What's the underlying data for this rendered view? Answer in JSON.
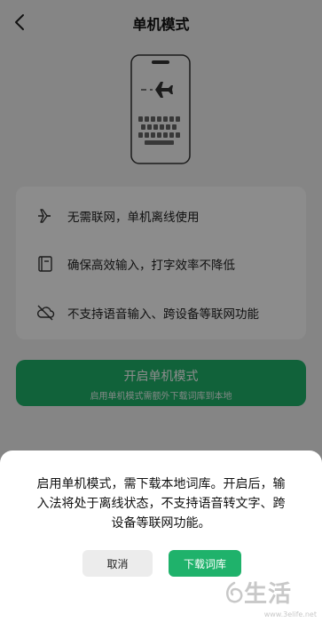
{
  "header": {
    "title": "单机模式"
  },
  "features": [
    {
      "icon": "airplane-icon",
      "text": "无需联网，单机离线使用"
    },
    {
      "icon": "book-icon",
      "text": "确保高效输入，打字效率不降低"
    },
    {
      "icon": "cloud-off-icon",
      "text": "不支持语音输入、跨设备等联网功能"
    }
  ],
  "enable_button": {
    "label": "开启单机模式",
    "sublabel": "启用单机模式需额外下载词库到本地"
  },
  "dialog": {
    "message": "启用单机模式，需下载本地词库。开启后，输入法将处于离线状态，不支持语音转文字、跨设备等联网功能。",
    "cancel_label": "取消",
    "download_label": "下载词库"
  },
  "watermark": {
    "text": "生活",
    "url": "www.3elife.net"
  },
  "colors": {
    "accent": "#1fb26b",
    "overlay": "rgba(0,0,0,0.45)"
  }
}
